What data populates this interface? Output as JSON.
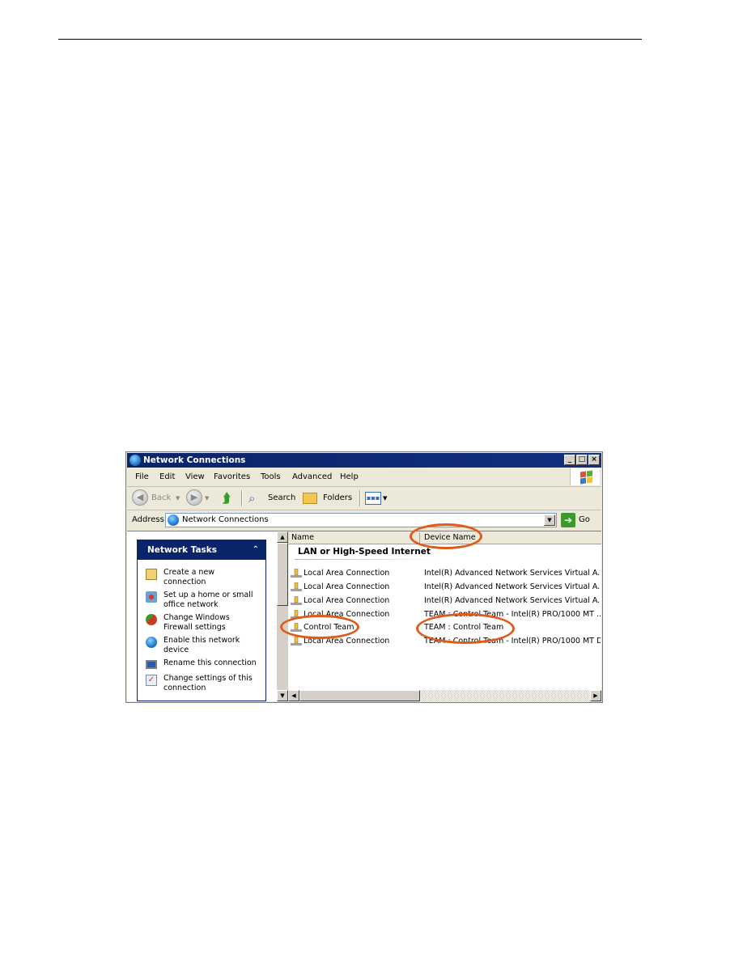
{
  "window": {
    "title": "Network Connections",
    "controls": {
      "minimize": "_",
      "maximize": "□",
      "close": "×"
    }
  },
  "menu": [
    {
      "label": "File",
      "accel": "F"
    },
    {
      "label": "Edit",
      "accel": "E"
    },
    {
      "label": "View",
      "accel": "V"
    },
    {
      "label": "Favorites",
      "accel": "a"
    },
    {
      "label": "Tools",
      "accel": "T"
    },
    {
      "label": "Advanced",
      "accel": "n"
    },
    {
      "label": "Help",
      "accel": "H"
    }
  ],
  "toolbar": {
    "back_label": "Back",
    "search_label": "Search",
    "folders_label": "Folders"
  },
  "address": {
    "label": "Address",
    "value": "Network Connections",
    "go_label": "Go"
  },
  "tasks": {
    "title": "Network Tasks",
    "collapse_glyph": "⌃",
    "items": [
      {
        "label": "Create a new connection",
        "icon": "new-connection-icon"
      },
      {
        "label": "Set up a home or small office network",
        "icon": "home-network-icon"
      },
      {
        "label": "Change Windows Firewall settings",
        "icon": "firewall-icon"
      },
      {
        "label": "Enable this network device",
        "icon": "enable-device-icon"
      },
      {
        "label": "Rename this connection",
        "icon": "rename-icon"
      },
      {
        "label": "Change settings of this connection",
        "icon": "settings-icon"
      }
    ]
  },
  "list": {
    "columns": [
      "Name",
      "Device Name"
    ],
    "group": "LAN or High-Speed Internet",
    "rows": [
      {
        "name": "Local Area Connection",
        "device": "Intel(R) Advanced Network Services Virtual A..."
      },
      {
        "name": "Local Area Connection",
        "device": "Intel(R) Advanced Network Services Virtual A..."
      },
      {
        "name": "Local Area Connection",
        "device": "Intel(R) Advanced Network Services Virtual A..."
      },
      {
        "name": "Local Area Connection",
        "device": "TEAM : Control Team - Intel(R) PRO/1000 MT ..."
      },
      {
        "name": "Control Team",
        "device": "TEAM : Control Team"
      },
      {
        "name": "Local Area Connection",
        "device": "TEAM : Control Team - Intel(R) PRO/1000 MT D..."
      }
    ]
  },
  "annotation_color": "#e05a1a"
}
